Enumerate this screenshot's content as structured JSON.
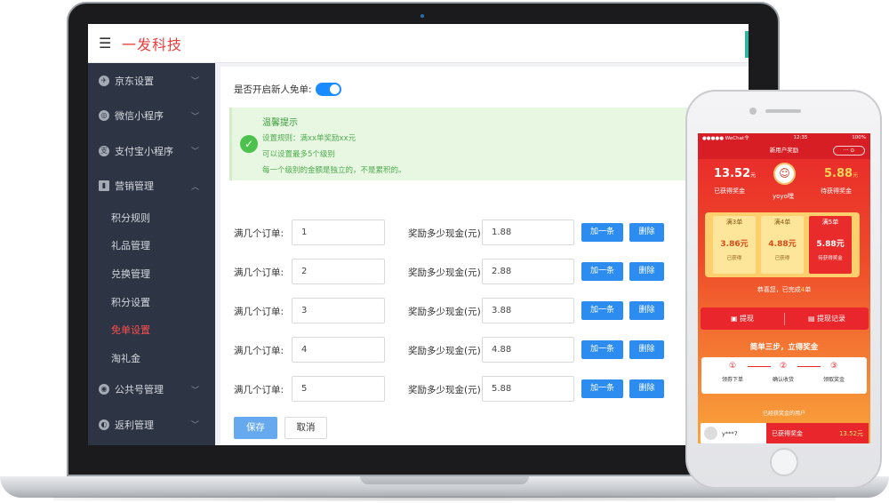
{
  "app": {
    "brand": "一发科技"
  },
  "sidebar": {
    "items": [
      {
        "label": "京东设置",
        "icon": "jd-icon",
        "expanded": false
      },
      {
        "label": "微信小程序",
        "icon": "wechat-miniapp-icon",
        "expanded": false
      },
      {
        "label": "支付宝小程序",
        "icon": "alipay-icon",
        "expanded": false
      },
      {
        "label": "营销管理",
        "icon": "marketing-icon",
        "expanded": true
      }
    ],
    "subitems": [
      {
        "label": "积分规则",
        "active": false
      },
      {
        "label": "礼品管理",
        "active": false
      },
      {
        "label": "兑换管理",
        "active": false
      },
      {
        "label": "积分设置",
        "active": false
      },
      {
        "label": "免单设置",
        "active": true
      },
      {
        "label": "淘礼金",
        "active": false
      }
    ],
    "items_after": [
      {
        "label": "公共号管理",
        "icon": "wechat-icon",
        "expanded": false
      },
      {
        "label": "返利管理",
        "icon": "rebate-icon",
        "expanded": false
      }
    ]
  },
  "form": {
    "toggle_label": "是否开启新人免单:",
    "toggle_on": true,
    "tip": {
      "title": "温馨提示",
      "line1": "设置规则：满xx单奖励xx元",
      "line2": "可以设置最多5个级别",
      "line3": "每一个级别的金额是独立的，不是累积的。"
    },
    "order_label": "满几个订单:",
    "reward_label": "奖励多少现金(元):",
    "add_label": "加一条",
    "delete_label": "删除",
    "rows": [
      {
        "orders": "1",
        "reward": "1.88"
      },
      {
        "orders": "2",
        "reward": "2.88"
      },
      {
        "orders": "3",
        "reward": "3.88"
      },
      {
        "orders": "4",
        "reward": "4.88"
      },
      {
        "orders": "5",
        "reward": "5.88"
      }
    ],
    "save_label": "保存",
    "cancel_label": "取消"
  },
  "phone": {
    "status_left": "●●●●● WeChat令",
    "status_time": "12:35",
    "status_right": "100%",
    "nav_title": "新用户奖励",
    "capsule": "··· ⊙",
    "earned_amount": "13.52",
    "earned_unit": "元",
    "earned_label": "已获得奖金",
    "user_name": "yoyo嘿",
    "pending_amount": "5.88",
    "pending_unit": "元",
    "pending_label": "待获得奖金",
    "levels": [
      {
        "title": "满3单",
        "value": "3.86元",
        "status": "已获得",
        "active": false
      },
      {
        "title": "满4单",
        "value": "4.88元",
        "status": "已获得",
        "active": false
      },
      {
        "title": "满5单",
        "value": "5.88元",
        "status": "待获得奖金",
        "active": true
      }
    ],
    "congrats_prefix": "恭喜您，已完成",
    "congrats_count": "4",
    "congrats_suffix": "单",
    "withdraw_label": "提现",
    "withdraw_record_label": "提现记录",
    "steps_title": "简单三步，立得奖金",
    "steps": [
      {
        "num": "①",
        "label": "领券下单"
      },
      {
        "num": "②",
        "label": "确认收货"
      },
      {
        "num": "③",
        "label": "领取奖金"
      }
    ],
    "users_title": "已经获奖金的用户",
    "user_row": {
      "name": "y***7",
      "text": "已获得奖金",
      "amount": "13.52元"
    }
  }
}
